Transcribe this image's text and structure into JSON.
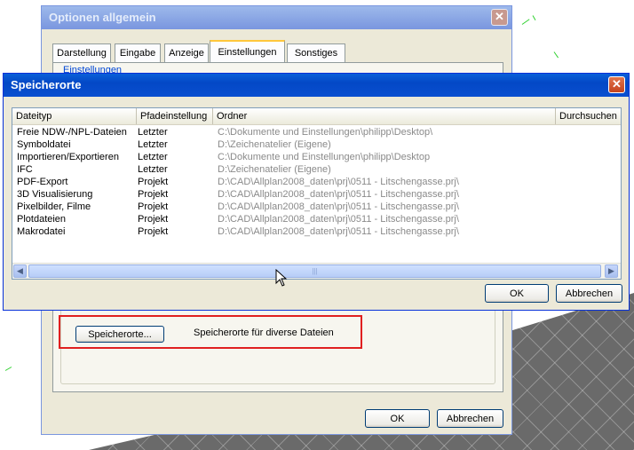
{
  "background_window": {
    "title": "Optionen allgemein",
    "close_glyph": "✕",
    "tabs": [
      "Darstellung",
      "Eingabe",
      "Anzeige",
      "Einstellungen",
      "Sonstiges"
    ],
    "active_tab": "Einstellungen",
    "group_legend": "Einstellungen",
    "speicherorte_button": "Speicherorte...",
    "speicherorte_desc": "Speicherorte für diverse Dateien",
    "ok_label": "OK",
    "cancel_label": "Abbrechen"
  },
  "dialog": {
    "title": "Speicherorte",
    "close_glyph": "✕",
    "columns": [
      "Dateityp",
      "Pfadeinstellung",
      "Ordner",
      "Durchsuchen"
    ],
    "rows": [
      {
        "type": "Freie NDW-/NPL-Dateien",
        "setting": "Letzter",
        "folder": "C:\\Dokumente und Einstellungen\\philipp\\Desktop\\"
      },
      {
        "type": "Symboldatei",
        "setting": "Letzter",
        "folder": "D:\\Zeichenatelier (Eigene)"
      },
      {
        "type": "Importieren/Exportieren",
        "setting": "Letzter",
        "folder": "C:\\Dokumente und Einstellungen\\philipp\\Desktop"
      },
      {
        "type": "IFC",
        "setting": "Letzter",
        "folder": "D:\\Zeichenatelier (Eigene)"
      },
      {
        "type": "PDF-Export",
        "setting": "Projekt",
        "folder": "D:\\CAD\\Allplan2008_daten\\prj\\0511 - Litschengasse.prj\\"
      },
      {
        "type": "3D Visualisierung",
        "setting": "Projekt",
        "folder": "D:\\CAD\\Allplan2008_daten\\prj\\0511 - Litschengasse.prj\\"
      },
      {
        "type": "Pixelbilder, Filme",
        "setting": "Projekt",
        "folder": "D:\\CAD\\Allplan2008_daten\\prj\\0511 - Litschengasse.prj\\"
      },
      {
        "type": "Plotdateien",
        "setting": "Projekt",
        "folder": "D:\\CAD\\Allplan2008_daten\\prj\\0511 - Litschengasse.prj\\"
      },
      {
        "type": "Makrodatei",
        "setting": "Projekt",
        "folder": "D:\\CAD\\Allplan2008_daten\\prj\\0511 - Litschengasse.prj\\"
      }
    ],
    "scroll_left": "◀",
    "scroll_right": "▶",
    "scroll_grip": "|||",
    "ok_label": "OK",
    "cancel_label": "Abbrechen"
  }
}
